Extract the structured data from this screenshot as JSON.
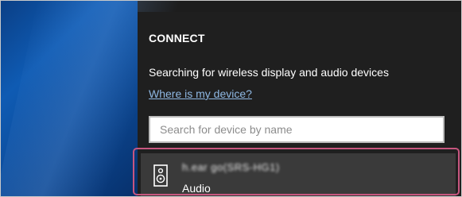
{
  "panel": {
    "title": "CONNECT",
    "status": "Searching for wireless display and audio devices",
    "help_link": "Where is my device?"
  },
  "search": {
    "placeholder": "Search for device by name",
    "value": ""
  },
  "devices": [
    {
      "name": "h.ear go(SRS-HG1)",
      "type": "Audio",
      "icon": "speaker-icon"
    }
  ],
  "colors": {
    "panel_bg": "#1f1f1f",
    "link": "#8fb8e3",
    "highlight": "#c7567f",
    "selected_item": "#3a3a3a"
  }
}
